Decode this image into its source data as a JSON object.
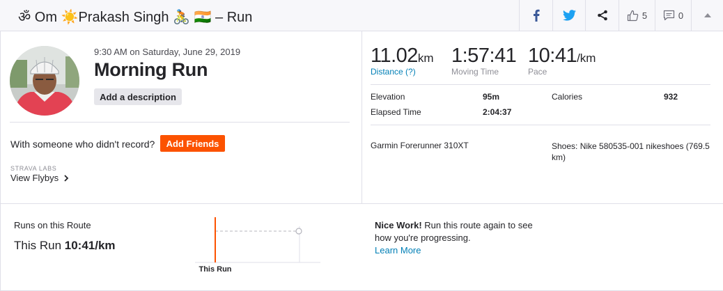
{
  "header": {
    "title": "ॐ Om ☀️Prakash Singh 🚴 🇮🇳 – Run",
    "kudos_count": "5",
    "comments_count": "0"
  },
  "activity": {
    "datetime": "9:30 AM on Saturday, June 29, 2019",
    "name": "Morning Run",
    "add_description_label": "Add a description"
  },
  "friends": {
    "prompt": "With someone who didn't record?",
    "button_label": "Add Friends"
  },
  "labs": {
    "label": "STRAVA LABS",
    "flybys_label": "View Flybys"
  },
  "stats": {
    "distance_value": "11.02",
    "distance_unit": "km",
    "distance_label": "Distance (?)",
    "moving_time_value": "1:57:41",
    "moving_time_label": "Moving Time",
    "pace_value": "10:41",
    "pace_unit": "/km",
    "pace_label": "Pace"
  },
  "details": {
    "elevation_label": "Elevation",
    "elevation_value": "95m",
    "calories_label": "Calories",
    "calories_value": "932",
    "elapsed_label": "Elapsed Time",
    "elapsed_value": "2:04:37"
  },
  "gear": {
    "device": "Garmin Forerunner 310XT",
    "shoes": "Shoes: Nike 580535-001 nikeshoes (769.5 km)"
  },
  "route": {
    "title": "Runs on this Route",
    "this_run_prefix": "This Run",
    "this_run_pace": "10:41/km",
    "chart_label": "This Run",
    "nice_title": "Nice Work!",
    "nice_text": "Run this route again to see how you're progressing.",
    "learn_more": "Learn More"
  },
  "colors": {
    "accent": "#fc5200",
    "link": "#007fb6",
    "facebook": "#3b5998",
    "twitter": "#1da1f2"
  }
}
